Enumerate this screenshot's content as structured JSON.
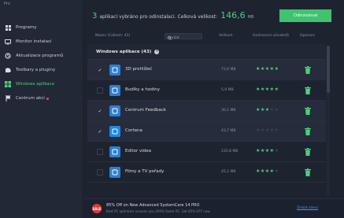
{
  "sidebar": {
    "brand": "Pro",
    "items": [
      {
        "label": "Programy",
        "icon": "grid-icon",
        "active": false
      },
      {
        "label": "Monitor instalací",
        "icon": "monitor-icon",
        "active": false
      },
      {
        "label": "Aktualizace programů",
        "icon": "refresh-icon",
        "active": false
      },
      {
        "label": "Toolbary a pluginy",
        "icon": "puzzle-icon",
        "active": false
      },
      {
        "label": "Windows aplikace",
        "icon": "windows-apps-icon",
        "active": true
      },
      {
        "label": "Centrum akcí",
        "icon": "flag-icon",
        "active": false,
        "badge": true
      }
    ]
  },
  "summary": {
    "count": "3",
    "text": "aplikací vybráno pro odinstalaci. Celková velikost:",
    "size": "146,6",
    "unit": "MB"
  },
  "remove_button": "Odinstalovat",
  "columns": {
    "name": "Název (Celkem: 43)",
    "search_placeholder": "Hledat",
    "size": "Velikost",
    "rating": "Hodnocení uživatelů",
    "action": "Operace"
  },
  "group": {
    "label": "Windows aplikace (43)"
  },
  "apps": [
    {
      "name": "3D prohlížeč",
      "size": "73,6 MB",
      "rating": 5,
      "checked": true,
      "icon_color": "#2b7fd4",
      "icon": "cube-icon"
    },
    {
      "name": "Budíky a hodiny",
      "size": "5,9 MB",
      "rating": 5,
      "checked": false,
      "icon_color": "#2b7fd4",
      "icon": "clock-icon"
    },
    {
      "name": "Centrum Feedback",
      "size": "30,1 MB",
      "rating": 3,
      "checked": true,
      "icon_color": "#2b7fd4",
      "icon": "feedback-icon"
    },
    {
      "name": "Cortana",
      "size": "43,7 MB",
      "rating": 0,
      "checked": true,
      "icon_color": "#1e88e5",
      "icon": "cortana-icon"
    },
    {
      "name": "Editor videa",
      "size": "235,8 MB",
      "rating": 4,
      "checked": false,
      "icon_color": "#2b7fd4",
      "icon": "video-icon"
    },
    {
      "name": "Filmy a TV pořady",
      "size": "45,1 MB",
      "rating": 4,
      "checked": false,
      "icon_color": "#2b7fd4",
      "icon": "film-icon"
    }
  ],
  "promo": {
    "icon_text": "SALE",
    "title": "85% Off on New Advanced SystemCare 14 PRO",
    "subtitle": "Best PC optimizer ensures you 200% faster PC. Get 85% OFF now.",
    "link": "Získat slevu"
  },
  "colors": {
    "accent": "#49d17a",
    "button": "#3fc36f",
    "background": "#1e2330",
    "sidebar": "#232836"
  }
}
